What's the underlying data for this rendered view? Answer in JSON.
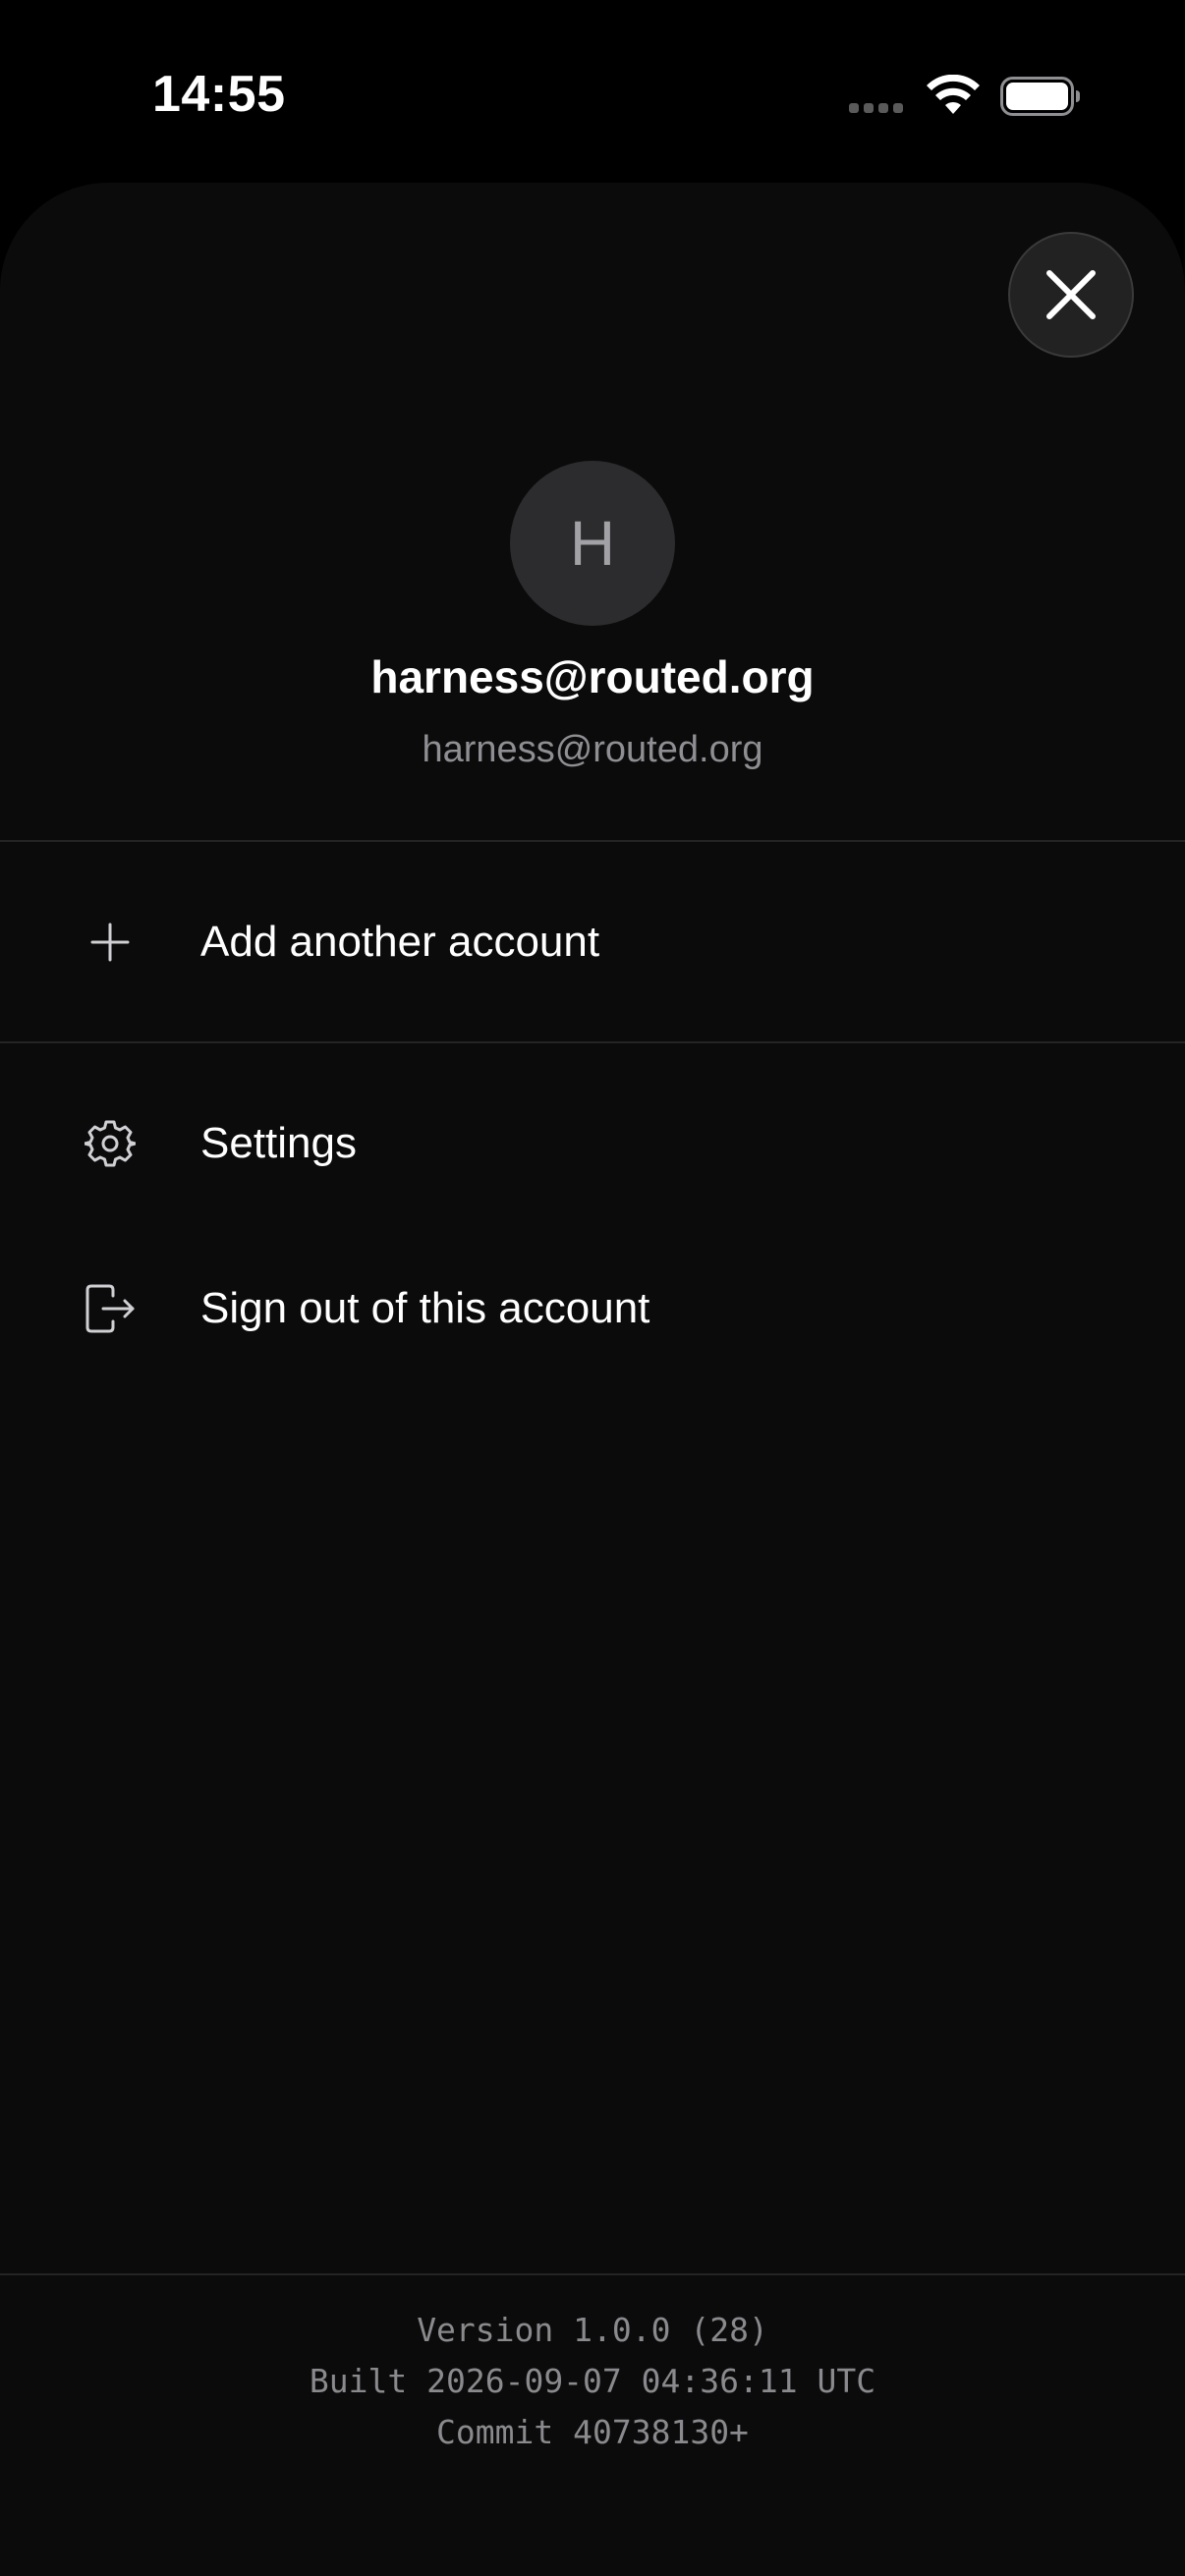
{
  "status_bar": {
    "time": "14:55"
  },
  "header": {
    "close_icon": "xmark-icon"
  },
  "account": {
    "avatar_initial": "H",
    "name": "harness@routed.org",
    "email": "harness@routed.org"
  },
  "menu": {
    "add_account": {
      "label": "Add another account",
      "icon": "plus-icon"
    },
    "settings": {
      "label": "Settings",
      "icon": "gear-icon"
    },
    "sign_out": {
      "label": "Sign out of this account",
      "icon": "sign-out-icon"
    }
  },
  "footer": {
    "version": "Version 1.0.0 (28)",
    "built": "Built 2026-09-07 04:36:11 UTC",
    "commit": "Commit 40738130+"
  },
  "colors": {
    "background": "#000000",
    "sheet": "#0b0b0b",
    "avatar": "#2c2c2e",
    "secondary_text": "#8e8e93",
    "divider": "#242424"
  }
}
